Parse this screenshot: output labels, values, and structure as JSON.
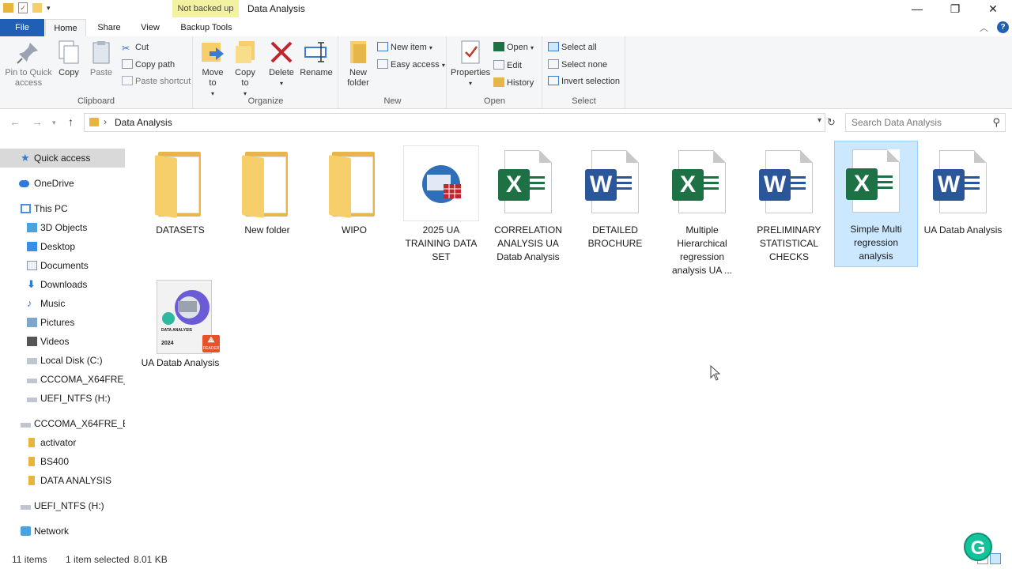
{
  "window": {
    "title": "Data Analysis",
    "context_tab": "Not backed up",
    "controls": {
      "minimize": "—",
      "maximize": "❐",
      "close": "✕"
    }
  },
  "ribbon_tabs": {
    "file": "File",
    "home": "Home",
    "share": "Share",
    "view": "View",
    "backup": "Backup Tools",
    "help": "?"
  },
  "clipboard": {
    "label": "Clipboard",
    "pin": "Pin to Quick access",
    "copy": "Copy",
    "paste": "Paste",
    "cut": "Cut",
    "copy_path": "Copy path",
    "paste_shortcut": "Paste shortcut"
  },
  "organize": {
    "label": "Organize",
    "move_to": "Move to",
    "copy_to": "Copy to",
    "delete": "Delete",
    "rename": "Rename"
  },
  "new_group": {
    "label": "New",
    "new_folder": "New folder",
    "new_item": "New item",
    "easy_access": "Easy access"
  },
  "open_group": {
    "label": "Open",
    "properties": "Properties",
    "open": "Open",
    "edit": "Edit",
    "history": "History"
  },
  "select_group": {
    "label": "Select",
    "select_all": "Select all",
    "select_none": "Select none",
    "invert": "Invert selection"
  },
  "address": {
    "path": "Data Analysis",
    "search_placeholder": "Search Data Analysis"
  },
  "nav": {
    "quick_access": "Quick access",
    "onedrive": "OneDrive",
    "this_pc": "This PC",
    "objects3d": "3D Objects",
    "desktop": "Desktop",
    "documents": "Documents",
    "downloads": "Downloads",
    "music": "Music",
    "pictures": "Pictures",
    "videos": "Videos",
    "local_disk": "Local Disk (C:)",
    "cccoma_sub": "CCCOMA_X64FRE_E",
    "uefi_sub": "UEFI_NTFS (H:)",
    "cccoma": "CCCOMA_X64FRE_EN",
    "activator": "activator",
    "bs400": "BS400",
    "data_analysis": "DATA ANALYSIS",
    "uefi": "UEFI_NTFS (H:)",
    "network": "Network"
  },
  "files": [
    {
      "name": "DATASETS",
      "type": "folder"
    },
    {
      "name": "New folder",
      "type": "folder"
    },
    {
      "name": "WIPO",
      "type": "folder"
    },
    {
      "name": "2025 UA TRAINING DATA SET",
      "type": "dataset"
    },
    {
      "name": "CORRELATION ANALYSIS UA Datab Analysis",
      "type": "excel"
    },
    {
      "name": "DETAILED BROCHURE",
      "type": "word"
    },
    {
      "name": "Multiple Hierarchical regression analysis UA ...",
      "type": "excel"
    },
    {
      "name": "PRELIMINARY STATISTICAL CHECKS",
      "type": "word"
    },
    {
      "name": "Simple Multi regression analysis",
      "type": "excel",
      "selected": true
    },
    {
      "name": "UA Datab Analysis",
      "type": "word"
    },
    {
      "name": "UA Datab Analysis",
      "type": "pdf-book"
    }
  ],
  "book_cover": {
    "title": "DATA ANALYSIS",
    "year": "2024",
    "reader_badge": "READER"
  },
  "status": {
    "items": "11 items",
    "selected": "1 item selected",
    "size": "8.01 KB"
  },
  "colors": {
    "accent": "#1f5fb5",
    "selection": "#cce8ff",
    "excel": "#1e7145",
    "word": "#2b579a",
    "folder": "#e6b64a"
  }
}
